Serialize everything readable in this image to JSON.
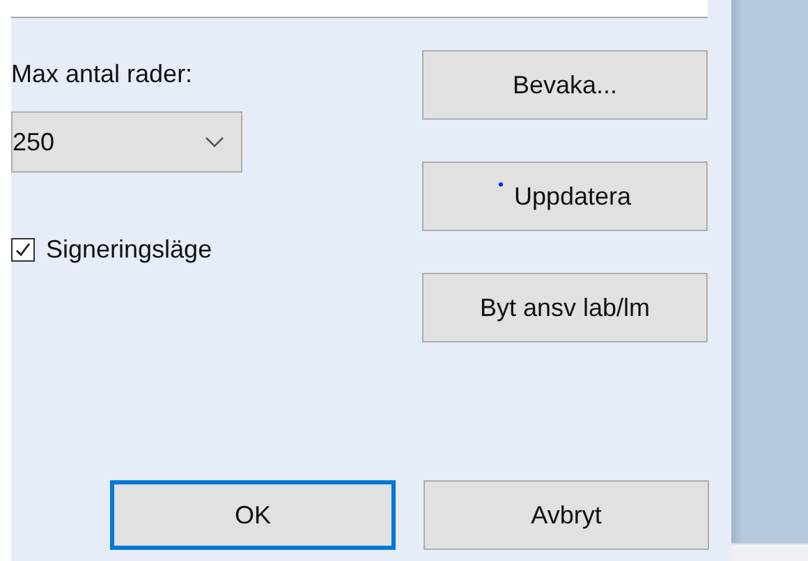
{
  "max_rows": {
    "label": "Max antal rader:",
    "value": "250"
  },
  "signing_mode": {
    "label": "Signeringsläge",
    "checked": true
  },
  "side_buttons": [
    {
      "label": "Bevaka...",
      "marker": false
    },
    {
      "label": "Uppdatera",
      "marker": true
    },
    {
      "label": "Byt ansv lab/lm",
      "marker": false
    }
  ],
  "dialog_buttons": [
    {
      "label": "OK",
      "selected": true
    },
    {
      "label": "Avbryt",
      "selected": false
    }
  ]
}
